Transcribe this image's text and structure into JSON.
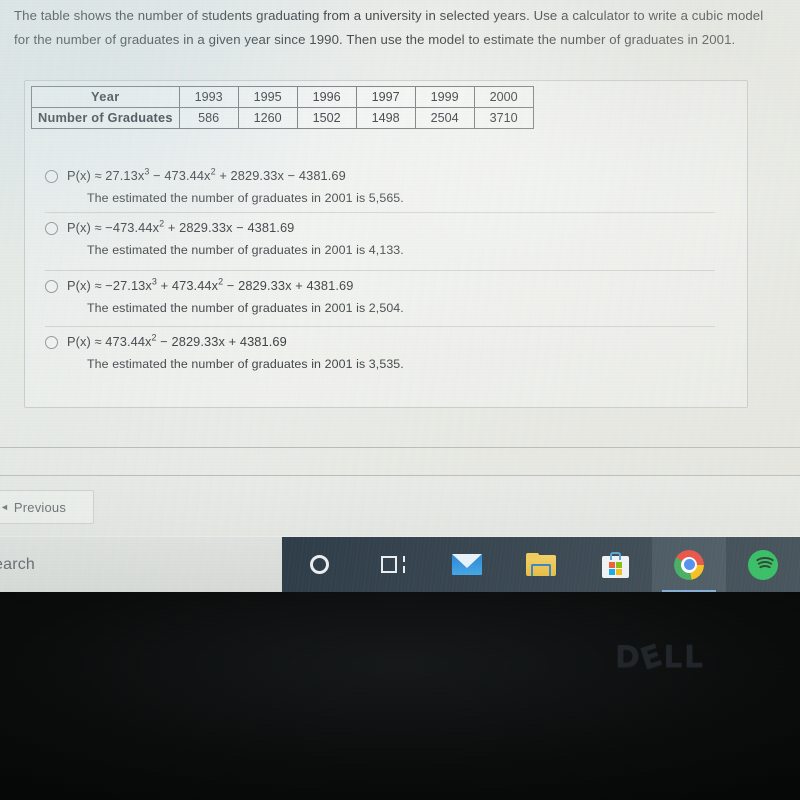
{
  "prompt": {
    "text": "The table shows the number of students graduating from a university in selected years. Use a calculator to write a cubic model for the number of graduates in a given year since 1990. Then use the model to estimate the number of graduates in 2001."
  },
  "table": {
    "row_headers": [
      "Year",
      "Number of Graduates"
    ],
    "years": [
      "1993",
      "1995",
      "1996",
      "1997",
      "1999",
      "2000"
    ],
    "graduates": [
      "586",
      "1260",
      "1502",
      "1498",
      "2504",
      "3710"
    ]
  },
  "options": [
    {
      "formula_prefix": "P(x) ≈ 27.13x",
      "exp1": "3",
      "formula_mid": " − 473.44x",
      "exp2": "2",
      "formula_suffix": " + 2829.33x − 4381.69",
      "estimate": "The estimated the number of graduates in 2001 is 5,565.",
      "selected": false
    },
    {
      "formula_prefix": "P(x) ≈ −473.44x",
      "exp1": "",
      "formula_mid": "",
      "exp2": "2",
      "formula_suffix": " + 2829.33x − 4381.69",
      "estimate": "The estimated the number of graduates in 2001 is 4,133.",
      "selected": false
    },
    {
      "formula_prefix": "P(x) ≈ −27.13x",
      "exp1": "3",
      "formula_mid": " + 473.44x",
      "exp2": "2",
      "formula_suffix": " − 2829.33x + 4381.69",
      "estimate": "The estimated the number of graduates in 2001 is 2,504.",
      "selected": false
    },
    {
      "formula_prefix": "P(x) ≈ 473.44x",
      "exp1": "",
      "formula_mid": "",
      "exp2": "2",
      "formula_suffix": " − 2829.33x + 4381.69",
      "estimate": "The estimated the number of graduates in 2001 is 3,535.",
      "selected": false
    }
  ],
  "nav": {
    "previous_label": "Previous",
    "previous_caret": "◄"
  },
  "taskbar": {
    "search_text": "earch",
    "icons": [
      "cortana-icon",
      "task-view-icon",
      "mail-icon",
      "file-explorer-icon",
      "microsoft-store-icon",
      "chrome-icon",
      "spotify-icon"
    ]
  },
  "device": {
    "brand": "DELL"
  },
  "colors": {
    "taskbar_bg": "#2b3a46",
    "screen_bg": "#e9ecea",
    "bezel": "#0b0d0d",
    "chrome_blue": "#4285f4",
    "spotify_green": "#1db954"
  }
}
